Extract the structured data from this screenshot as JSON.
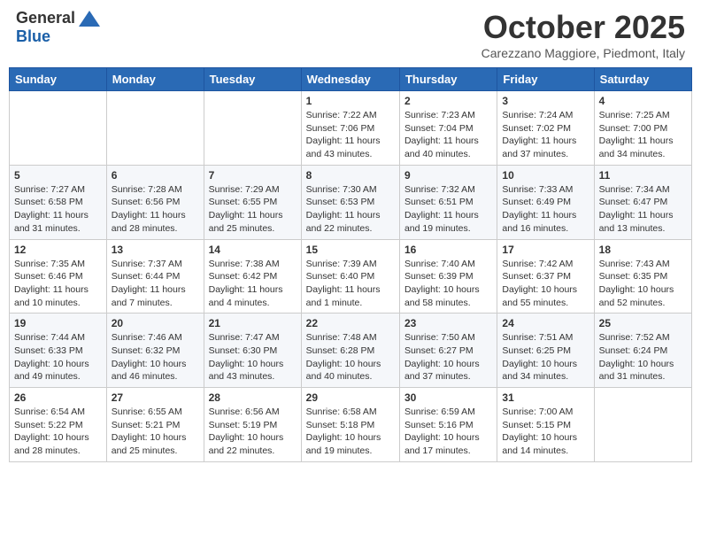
{
  "header": {
    "logo_general": "General",
    "logo_blue": "Blue",
    "month": "October 2025",
    "location": "Carezzano Maggiore, Piedmont, Italy"
  },
  "weekdays": [
    "Sunday",
    "Monday",
    "Tuesday",
    "Wednesday",
    "Thursday",
    "Friday",
    "Saturday"
  ],
  "weeks": [
    [
      {
        "day": "",
        "sunrise": "",
        "sunset": "",
        "daylight": ""
      },
      {
        "day": "",
        "sunrise": "",
        "sunset": "",
        "daylight": ""
      },
      {
        "day": "",
        "sunrise": "",
        "sunset": "",
        "daylight": ""
      },
      {
        "day": "1",
        "sunrise": "Sunrise: 7:22 AM",
        "sunset": "Sunset: 7:06 PM",
        "daylight": "Daylight: 11 hours and 43 minutes."
      },
      {
        "day": "2",
        "sunrise": "Sunrise: 7:23 AM",
        "sunset": "Sunset: 7:04 PM",
        "daylight": "Daylight: 11 hours and 40 minutes."
      },
      {
        "day": "3",
        "sunrise": "Sunrise: 7:24 AM",
        "sunset": "Sunset: 7:02 PM",
        "daylight": "Daylight: 11 hours and 37 minutes."
      },
      {
        "day": "4",
        "sunrise": "Sunrise: 7:25 AM",
        "sunset": "Sunset: 7:00 PM",
        "daylight": "Daylight: 11 hours and 34 minutes."
      }
    ],
    [
      {
        "day": "5",
        "sunrise": "Sunrise: 7:27 AM",
        "sunset": "Sunset: 6:58 PM",
        "daylight": "Daylight: 11 hours and 31 minutes."
      },
      {
        "day": "6",
        "sunrise": "Sunrise: 7:28 AM",
        "sunset": "Sunset: 6:56 PM",
        "daylight": "Daylight: 11 hours and 28 minutes."
      },
      {
        "day": "7",
        "sunrise": "Sunrise: 7:29 AM",
        "sunset": "Sunset: 6:55 PM",
        "daylight": "Daylight: 11 hours and 25 minutes."
      },
      {
        "day": "8",
        "sunrise": "Sunrise: 7:30 AM",
        "sunset": "Sunset: 6:53 PM",
        "daylight": "Daylight: 11 hours and 22 minutes."
      },
      {
        "day": "9",
        "sunrise": "Sunrise: 7:32 AM",
        "sunset": "Sunset: 6:51 PM",
        "daylight": "Daylight: 11 hours and 19 minutes."
      },
      {
        "day": "10",
        "sunrise": "Sunrise: 7:33 AM",
        "sunset": "Sunset: 6:49 PM",
        "daylight": "Daylight: 11 hours and 16 minutes."
      },
      {
        "day": "11",
        "sunrise": "Sunrise: 7:34 AM",
        "sunset": "Sunset: 6:47 PM",
        "daylight": "Daylight: 11 hours and 13 minutes."
      }
    ],
    [
      {
        "day": "12",
        "sunrise": "Sunrise: 7:35 AM",
        "sunset": "Sunset: 6:46 PM",
        "daylight": "Daylight: 11 hours and 10 minutes."
      },
      {
        "day": "13",
        "sunrise": "Sunrise: 7:37 AM",
        "sunset": "Sunset: 6:44 PM",
        "daylight": "Daylight: 11 hours and 7 minutes."
      },
      {
        "day": "14",
        "sunrise": "Sunrise: 7:38 AM",
        "sunset": "Sunset: 6:42 PM",
        "daylight": "Daylight: 11 hours and 4 minutes."
      },
      {
        "day": "15",
        "sunrise": "Sunrise: 7:39 AM",
        "sunset": "Sunset: 6:40 PM",
        "daylight": "Daylight: 11 hours and 1 minute."
      },
      {
        "day": "16",
        "sunrise": "Sunrise: 7:40 AM",
        "sunset": "Sunset: 6:39 PM",
        "daylight": "Daylight: 10 hours and 58 minutes."
      },
      {
        "day": "17",
        "sunrise": "Sunrise: 7:42 AM",
        "sunset": "Sunset: 6:37 PM",
        "daylight": "Daylight: 10 hours and 55 minutes."
      },
      {
        "day": "18",
        "sunrise": "Sunrise: 7:43 AM",
        "sunset": "Sunset: 6:35 PM",
        "daylight": "Daylight: 10 hours and 52 minutes."
      }
    ],
    [
      {
        "day": "19",
        "sunrise": "Sunrise: 7:44 AM",
        "sunset": "Sunset: 6:33 PM",
        "daylight": "Daylight: 10 hours and 49 minutes."
      },
      {
        "day": "20",
        "sunrise": "Sunrise: 7:46 AM",
        "sunset": "Sunset: 6:32 PM",
        "daylight": "Daylight: 10 hours and 46 minutes."
      },
      {
        "day": "21",
        "sunrise": "Sunrise: 7:47 AM",
        "sunset": "Sunset: 6:30 PM",
        "daylight": "Daylight: 10 hours and 43 minutes."
      },
      {
        "day": "22",
        "sunrise": "Sunrise: 7:48 AM",
        "sunset": "Sunset: 6:28 PM",
        "daylight": "Daylight: 10 hours and 40 minutes."
      },
      {
        "day": "23",
        "sunrise": "Sunrise: 7:50 AM",
        "sunset": "Sunset: 6:27 PM",
        "daylight": "Daylight: 10 hours and 37 minutes."
      },
      {
        "day": "24",
        "sunrise": "Sunrise: 7:51 AM",
        "sunset": "Sunset: 6:25 PM",
        "daylight": "Daylight: 10 hours and 34 minutes."
      },
      {
        "day": "25",
        "sunrise": "Sunrise: 7:52 AM",
        "sunset": "Sunset: 6:24 PM",
        "daylight": "Daylight: 10 hours and 31 minutes."
      }
    ],
    [
      {
        "day": "26",
        "sunrise": "Sunrise: 6:54 AM",
        "sunset": "Sunset: 5:22 PM",
        "daylight": "Daylight: 10 hours and 28 minutes."
      },
      {
        "day": "27",
        "sunrise": "Sunrise: 6:55 AM",
        "sunset": "Sunset: 5:21 PM",
        "daylight": "Daylight: 10 hours and 25 minutes."
      },
      {
        "day": "28",
        "sunrise": "Sunrise: 6:56 AM",
        "sunset": "Sunset: 5:19 PM",
        "daylight": "Daylight: 10 hours and 22 minutes."
      },
      {
        "day": "29",
        "sunrise": "Sunrise: 6:58 AM",
        "sunset": "Sunset: 5:18 PM",
        "daylight": "Daylight: 10 hours and 19 minutes."
      },
      {
        "day": "30",
        "sunrise": "Sunrise: 6:59 AM",
        "sunset": "Sunset: 5:16 PM",
        "daylight": "Daylight: 10 hours and 17 minutes."
      },
      {
        "day": "31",
        "sunrise": "Sunrise: 7:00 AM",
        "sunset": "Sunset: 5:15 PM",
        "daylight": "Daylight: 10 hours and 14 minutes."
      },
      {
        "day": "",
        "sunrise": "",
        "sunset": "",
        "daylight": ""
      }
    ]
  ]
}
